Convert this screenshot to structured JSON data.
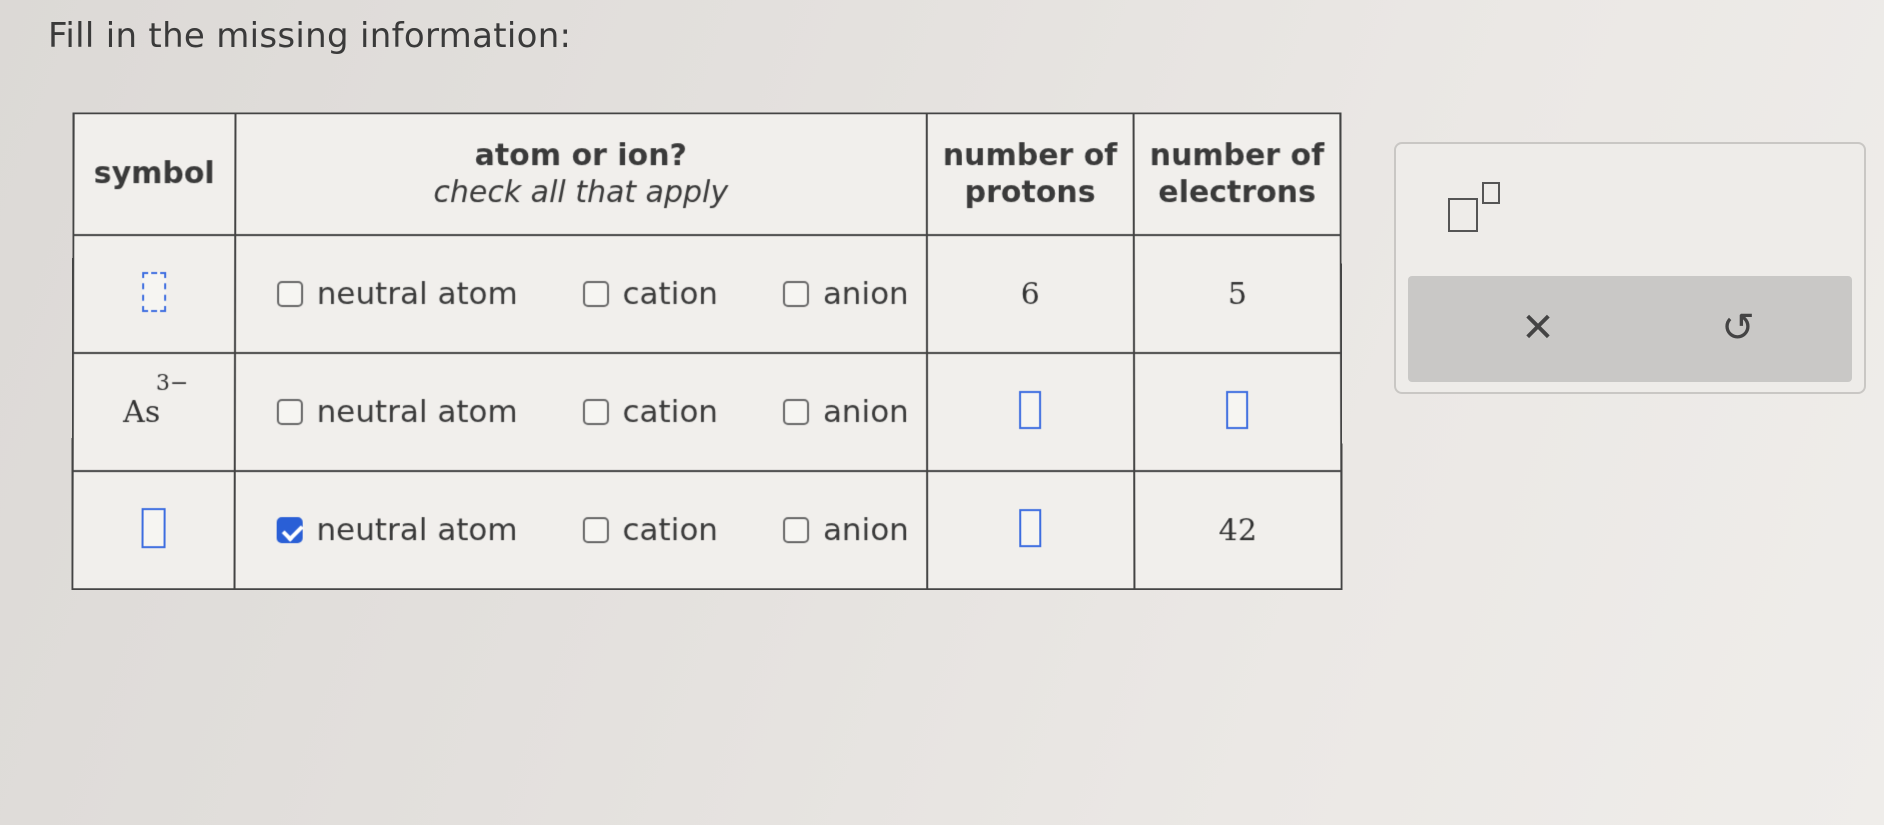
{
  "prompt": "Fill in the missing information:",
  "table": {
    "headers": {
      "symbol": "symbol",
      "type_title": "atom or ion?",
      "type_subtitle": "check all that apply",
      "protons": "number of protons",
      "electrons": "number of electrons"
    },
    "options": [
      "neutral atom",
      "cation",
      "anion"
    ],
    "rows": [
      {
        "symbol": "",
        "symbol_charge": "",
        "checked": [
          false,
          false,
          false
        ],
        "protons": "6",
        "electrons": "5"
      },
      {
        "symbol": "As",
        "symbol_charge": "3−",
        "checked": [
          false,
          false,
          false
        ],
        "protons": "",
        "electrons": ""
      },
      {
        "symbol": "",
        "symbol_charge": "",
        "checked": [
          true,
          false,
          false
        ],
        "protons": "",
        "electrons": "42"
      }
    ]
  },
  "panel": {
    "tool_icon": "superscript-icon",
    "clear_icon": "close-icon",
    "clear_glyph": "✕",
    "undo_icon": "undo-icon",
    "undo_glyph": "↺"
  },
  "colors": {
    "accent": "#2a5fd6",
    "answer_box": "#3d6de0"
  }
}
